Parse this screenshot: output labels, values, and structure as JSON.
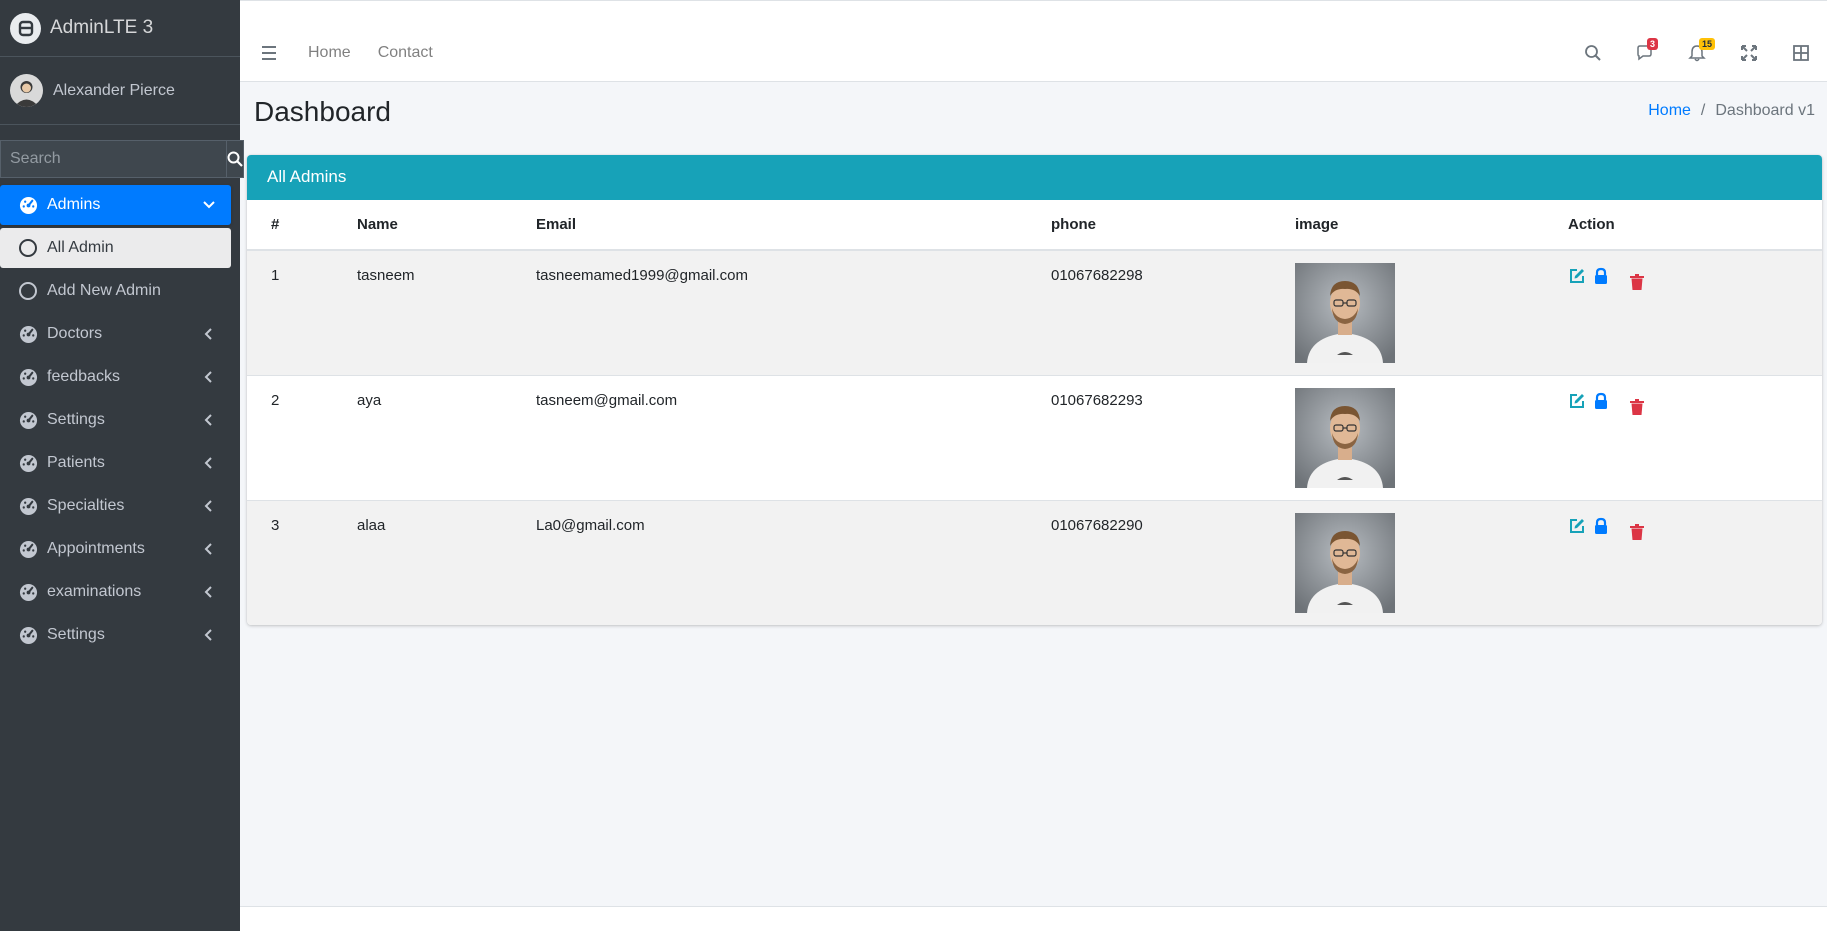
{
  "brand": {
    "name": "AdminLTE 3"
  },
  "user": {
    "name": "Alexander Pierce"
  },
  "sidebar_search": {
    "placeholder": "Search"
  },
  "sidebar": {
    "items": [
      {
        "label": "Admins",
        "state": "active",
        "arrow": "down",
        "icon": "tachometer-icon"
      },
      {
        "label": "All Admin",
        "state": "sub-active",
        "icon": "circle-icon"
      },
      {
        "label": "Add New Admin",
        "state": "sub",
        "icon": "circle-icon"
      },
      {
        "label": "Doctors",
        "state": "",
        "arrow": "left",
        "icon": "tachometer-icon"
      },
      {
        "label": "feedbacks",
        "state": "",
        "arrow": "left",
        "icon": "tachometer-icon"
      },
      {
        "label": "Settings",
        "state": "",
        "arrow": "left",
        "icon": "tachometer-icon"
      },
      {
        "label": "Patients",
        "state": "",
        "arrow": "left",
        "icon": "tachometer-icon"
      },
      {
        "label": "Specialties",
        "state": "",
        "arrow": "left",
        "icon": "tachometer-icon"
      },
      {
        "label": "Appointments",
        "state": "",
        "arrow": "left",
        "icon": "tachometer-icon"
      },
      {
        "label": "examinations",
        "state": "",
        "arrow": "left",
        "icon": "tachometer-icon"
      },
      {
        "label": "Settings",
        "state": "",
        "arrow": "left",
        "icon": "tachometer-icon"
      }
    ]
  },
  "topnav": {
    "links": [
      "Home",
      "Contact"
    ],
    "messages_badge": "3",
    "notifications_badge": "15"
  },
  "page": {
    "title": "Dashboard",
    "breadcrumb_home": "Home",
    "breadcrumb_current": "Dashboard v1"
  },
  "card": {
    "title": "All Admins",
    "columns": [
      "#",
      "Name",
      "Email",
      "phone",
      "image",
      "Action"
    ],
    "rows": [
      {
        "id": "1",
        "name": "tasneem",
        "email": "tasneemamed1999@gmail.com",
        "phone": "01067682298"
      },
      {
        "id": "2",
        "name": "aya",
        "email": "tasneem@gmail.com",
        "phone": "01067682293"
      },
      {
        "id": "3",
        "name": "alaa",
        "email": "La0@gmail.com",
        "phone": "01067682290"
      }
    ]
  },
  "colors": {
    "sidebar": "#343a40",
    "primary": "#007bff",
    "card_header": "#17a2b8",
    "edit": "#17a2b8",
    "lock": "#007bff",
    "delete": "#dc3545"
  }
}
